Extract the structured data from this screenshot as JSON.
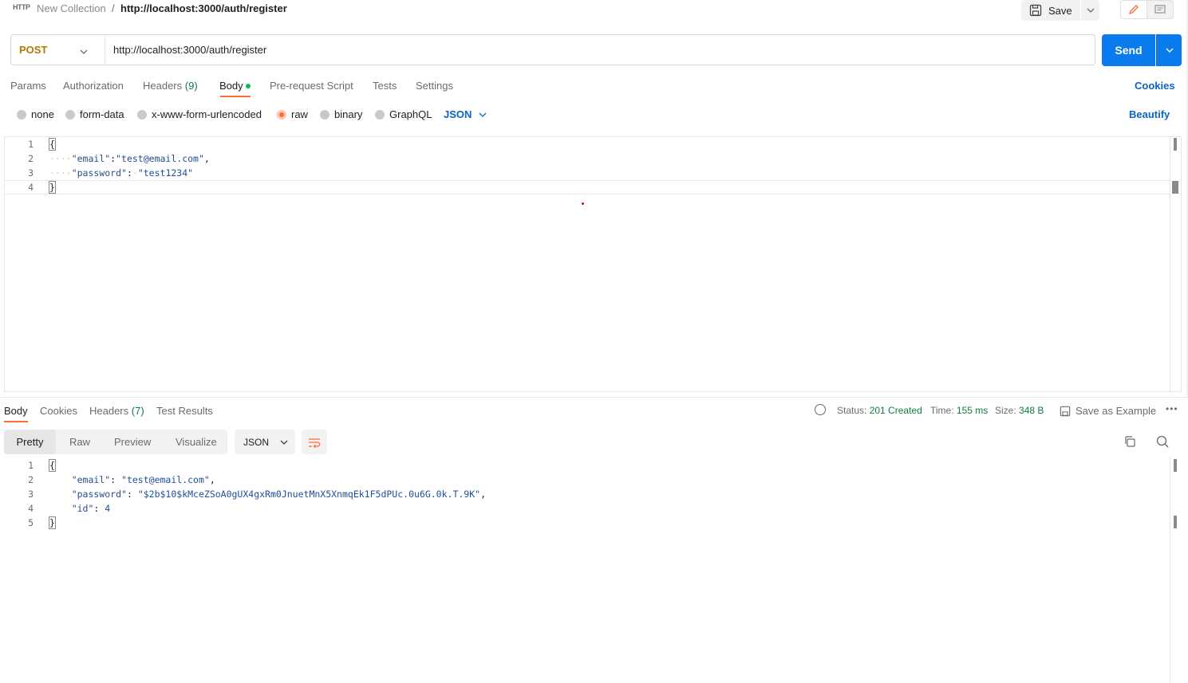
{
  "breadcrumb": {
    "icon_label": "HTTP",
    "collection": "New Collection",
    "separator": "/",
    "request_name": "http://localhost:3000/auth/register"
  },
  "toolbar": {
    "save_label": "Save"
  },
  "request": {
    "method": "POST",
    "url": "http://localhost:3000/auth/register",
    "send_label": "Send"
  },
  "request_tabs": {
    "params": "Params",
    "authorization": "Authorization",
    "headers": "Headers",
    "headers_count": "(9)",
    "body": "Body",
    "prerequest": "Pre-request Script",
    "tests": "Tests",
    "settings": "Settings",
    "cookies": "Cookies"
  },
  "body_types": {
    "none": "none",
    "form_data": "form-data",
    "urlencoded": "x-www-form-urlencoded",
    "raw": "raw",
    "binary": "binary",
    "graphql": "GraphQL",
    "selected_language": "JSON",
    "beautify": "Beautify"
  },
  "request_body": {
    "line_numbers": [
      "1",
      "2",
      "3",
      "4"
    ],
    "open_brace": "{",
    "email_key": "\"email\"",
    "email_value": "\"test@email.com\"",
    "password_key": "\"password\"",
    "password_value": "\"test1234\"",
    "close_brace": "}"
  },
  "response_tabs": {
    "body": "Body",
    "cookies": "Cookies",
    "headers": "Headers",
    "headers_count": "(7)",
    "test_results": "Test Results"
  },
  "response_status": {
    "status_label": "Status:",
    "status_value": "201 Created",
    "time_label": "Time:",
    "time_value": "155 ms",
    "size_label": "Size:",
    "size_value": "348 B",
    "save_example": "Save as Example",
    "more": "•••"
  },
  "response_view": {
    "pretty": "Pretty",
    "raw": "Raw",
    "preview": "Preview",
    "visualize": "Visualize",
    "format": "JSON"
  },
  "response_body": {
    "line_numbers": [
      "1",
      "2",
      "3",
      "4",
      "5"
    ],
    "open_brace": "{",
    "email_key": "\"email\"",
    "email_value": "\"test@email.com\"",
    "password_key": "\"password\"",
    "password_value": "\"$2b$10$kMceZSoA0gUX4gxRm0JnuetMnX5XnmqEk1F5dPUc.0u6G.0k.T.9K\"",
    "id_key": "\"id\"",
    "id_value": "4",
    "close_brace": "}"
  },
  "colors": {
    "accent_orange": "#ff6c37",
    "send_blue": "#097bed",
    "link_blue": "#0b65c2",
    "status_green": "#0f7b40",
    "method_post": "#b07a00"
  },
  "icons": [
    "http-icon",
    "save-icon",
    "chevron-down-icon",
    "edit-icon",
    "comment-icon",
    "globe-icon",
    "save-example-icon",
    "more-icon",
    "wrap-icon",
    "copy-icon",
    "search-icon"
  ]
}
